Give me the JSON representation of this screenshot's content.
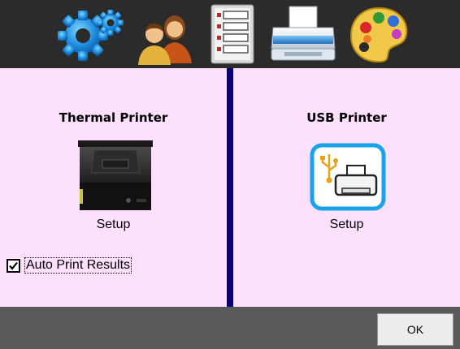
{
  "toolbar": {
    "icons": [
      {
        "name": "gear-icon"
      },
      {
        "name": "users-icon"
      },
      {
        "name": "list-icon"
      },
      {
        "name": "printer-icon"
      },
      {
        "name": "palette-icon"
      }
    ]
  },
  "left_panel": {
    "title": "Thermal Printer",
    "setup_label": "Setup",
    "auto_print": {
      "label": "Auto Print Results",
      "checked": true
    }
  },
  "right_panel": {
    "title": "USB Printer",
    "setup_label": "Setup"
  },
  "footer": {
    "ok_label": "OK"
  },
  "colors": {
    "toolbar_bg": "#2b2b2b",
    "panel_bg": "#fde0fc",
    "divider": "#08007a",
    "footer_bg": "#5a5a5a",
    "usb_accent": "#1aa3e8"
  }
}
